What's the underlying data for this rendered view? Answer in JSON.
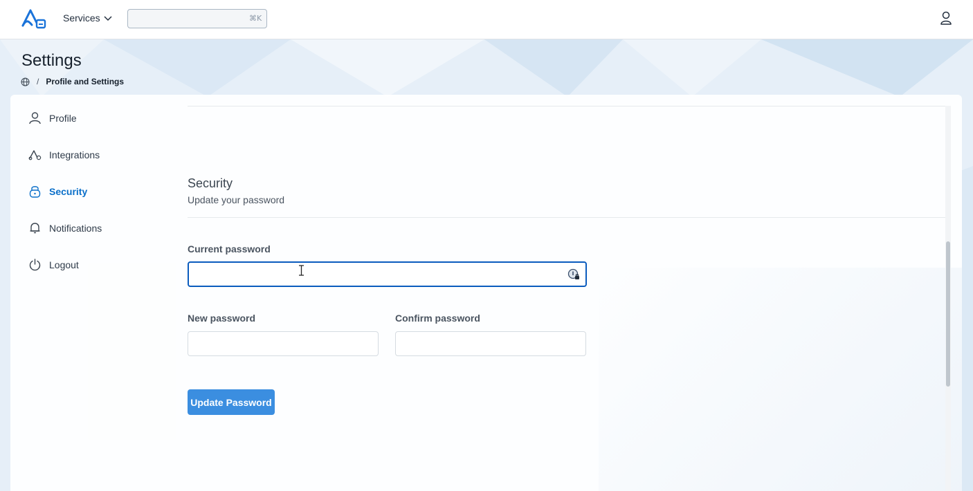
{
  "topbar": {
    "services_label": "Services",
    "search": {
      "value": "",
      "placeholder": ""
    },
    "shortcut": "⌘K"
  },
  "page": {
    "title": "Settings",
    "breadcrumb": [
      "Profile and Settings"
    ]
  },
  "sidebar": {
    "items": [
      {
        "label": "Profile",
        "icon": "user-icon"
      },
      {
        "label": "Integrations",
        "icon": "integrations-icon"
      },
      {
        "label": "Security",
        "icon": "lock-icon",
        "active": true
      },
      {
        "label": "Notifications",
        "icon": "bell-icon"
      },
      {
        "label": "Logout",
        "icon": "power-icon"
      }
    ]
  },
  "security": {
    "title": "Security",
    "subtitle": "Update your password",
    "current_password_label": "Current password",
    "new_password_label": "New password",
    "confirm_password_label": "Confirm password",
    "current_password_value": "",
    "new_password_value": "",
    "confirm_password_value": "",
    "submit_label": "Update Password"
  },
  "colors": {
    "accent": "#0a6fc9",
    "button": "#3b8ee0",
    "focus_border": "#0a5bbd"
  }
}
